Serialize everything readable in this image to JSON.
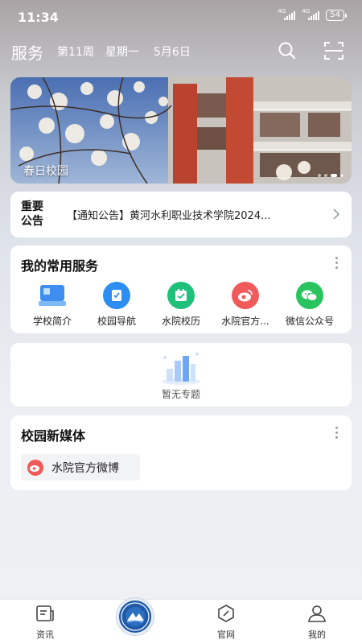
{
  "status_bar": {
    "time": "11:34",
    "signal1_label": "4G",
    "signal2_label": "4G",
    "battery": "54"
  },
  "header": {
    "title": "服务",
    "week": "第11周",
    "weekday": "星期一",
    "date": "5月6日"
  },
  "banner": {
    "caption": "春日校园"
  },
  "notice": {
    "label": "重要公告",
    "text": "【通知公告】黄河水利职业技术学院2024..."
  },
  "services": {
    "title": "我的常用服务",
    "items": [
      {
        "label": "学校简介",
        "icon": "school-intro-icon",
        "color": "#3d8ef0"
      },
      {
        "label": "校园导航",
        "icon": "campus-nav-icon",
        "color": "#2c8df2"
      },
      {
        "label": "水院校历",
        "icon": "calendar-icon",
        "color": "#1fc07a"
      },
      {
        "label": "水院官方...",
        "icon": "weibo-icon",
        "color": "#f05a5a"
      },
      {
        "label": "微信公众号",
        "icon": "wechat-icon",
        "color": "#29c35f"
      }
    ]
  },
  "topics": {
    "empty_text": "暂无专题"
  },
  "media": {
    "title": "校园新媒体",
    "chip_label": "水院官方微博"
  },
  "bottom_nav": {
    "news": "资讯",
    "official_site": "官网",
    "mine": "我的"
  },
  "colors": {
    "accent": "#1e5aa8",
    "weibo": "#f05a5a"
  }
}
